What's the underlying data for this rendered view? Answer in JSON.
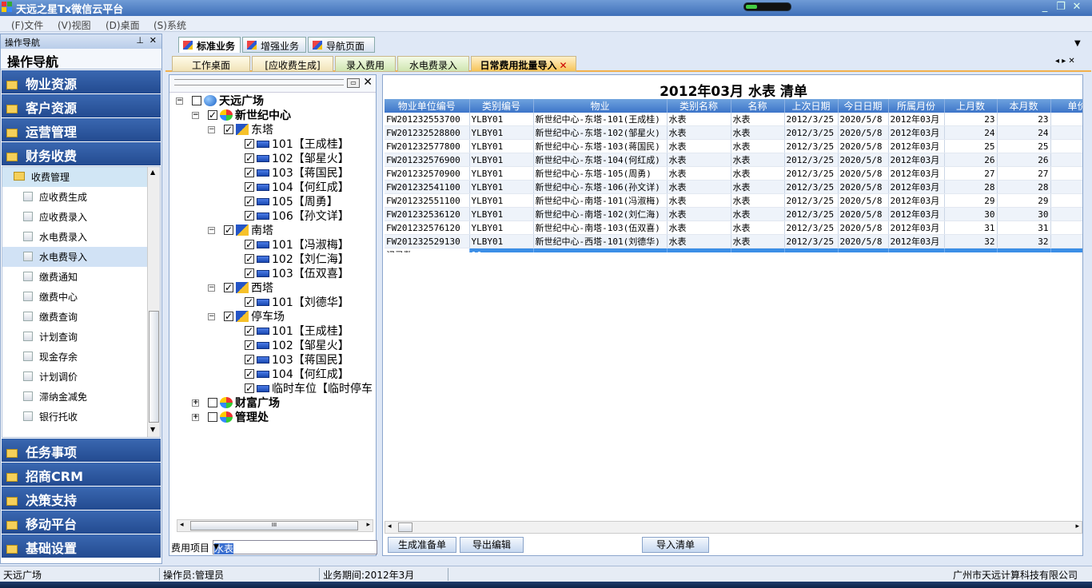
{
  "window": {
    "title": "天远之星Tx微信云平台"
  },
  "menu": [
    "(F)文件",
    "(V)视图",
    "(D)桌面",
    "(S)系统"
  ],
  "nav": {
    "header": "操作导航",
    "title": "操作导航",
    "categories_top": [
      "物业资源",
      "客户资源",
      "运营管理",
      "财务收费"
    ],
    "group": "收费管理",
    "items": [
      "应收费生成",
      "应收费录入",
      "水电费录入",
      "水电费导入",
      "缴费通知",
      "缴费中心",
      "缴费查询",
      "计划查询",
      "现金存余",
      "计划调价",
      "滞纳金减免",
      "银行托收"
    ],
    "selected_item": "水电费导入",
    "categories_bottom": [
      "任务事项",
      "招商CRM",
      "决策支持",
      "移动平台",
      "基础设置"
    ]
  },
  "tabs_top": [
    "标准业务",
    "增强业务",
    "导航页面"
  ],
  "tabs_doc": [
    "工作桌面",
    "[应收费生成]",
    "录入费用",
    "水电费录入",
    "日常费用批量导入"
  ],
  "tree": {
    "root": "天远广场",
    "center": "新世纪中心",
    "buildings": [
      {
        "name": "东塔",
        "units": [
          "101【王成桂】",
          "102【邹星火】",
          "103【蒋国民】",
          "104【何红成】",
          "105【周勇】",
          "106【孙文详】"
        ]
      },
      {
        "name": "南塔",
        "units": [
          "101【冯淑梅】",
          "102【刘仁海】",
          "103【伍双喜】"
        ]
      },
      {
        "name": "西塔",
        "units": [
          "101【刘德华】"
        ]
      },
      {
        "name": "停车场",
        "units": [
          "101【王成桂】",
          "102【邹星火】",
          "103【蒋国民】",
          "104【何红成】",
          "临时车位【临时停车】"
        ]
      }
    ],
    "others": [
      "财富广场",
      "管理处"
    ],
    "scroll_mid": "III",
    "fee_label": "费用项目",
    "fee_value": "水表"
  },
  "grid": {
    "title": "2012年03月  水表  清单",
    "columns": [
      "物业单位编号",
      "类别编号",
      "物业",
      "类别名称",
      "名称",
      "上次日期",
      "今日日期",
      "所属月份",
      "上月数",
      "本月数",
      "单价"
    ],
    "rows": [
      [
        "FW201232553700",
        "YLBY01",
        "新世纪中心-东塔-101(王成桂)",
        "水表",
        "水表",
        "2012/3/25",
        "2020/5/8",
        "2012年03月",
        "23",
        "23",
        "0."
      ],
      [
        "FW201232528800",
        "YLBY01",
        "新世纪中心-东塔-102(邹星火)",
        "水表",
        "水表",
        "2012/3/25",
        "2020/5/8",
        "2012年03月",
        "24",
        "24",
        "0."
      ],
      [
        "FW201232577800",
        "YLBY01",
        "新世纪中心-东塔-103(蒋国民)",
        "水表",
        "水表",
        "2012/3/25",
        "2020/5/8",
        "2012年03月",
        "25",
        "25",
        "0."
      ],
      [
        "FW201232576900",
        "YLBY01",
        "新世纪中心-东塔-104(何红成)",
        "水表",
        "水表",
        "2012/3/25",
        "2020/5/8",
        "2012年03月",
        "26",
        "26",
        "0."
      ],
      [
        "FW201232570900",
        "YLBY01",
        "新世纪中心-东塔-105(周勇)",
        "水表",
        "水表",
        "2012/3/25",
        "2020/5/8",
        "2012年03月",
        "27",
        "27",
        "0."
      ],
      [
        "FW201232541100",
        "YLBY01",
        "新世纪中心-东塔-106(孙文详)",
        "水表",
        "水表",
        "2012/3/25",
        "2020/5/8",
        "2012年03月",
        "28",
        "28",
        "0."
      ],
      [
        "FW201232551100",
        "YLBY01",
        "新世纪中心-南塔-101(冯淑梅)",
        "水表",
        "水表",
        "2012/3/25",
        "2020/5/8",
        "2012年03月",
        "29",
        "29",
        "0."
      ],
      [
        "FW201232536120",
        "YLBY01",
        "新世纪中心-南塔-102(刘仁海)",
        "水表",
        "水表",
        "2012/3/25",
        "2020/5/8",
        "2012年03月",
        "30",
        "30",
        "0."
      ],
      [
        "FW201232576120",
        "YLBY01",
        "新世纪中心-南塔-103(伍双喜)",
        "水表",
        "水表",
        "2012/3/25",
        "2020/5/8",
        "2012年03月",
        "31",
        "31",
        "0."
      ],
      [
        "FW201232529130",
        "YLBY01",
        "新世纪中心-西塔-101(刘德华)",
        "水表",
        "水表",
        "2012/3/25",
        "2020/5/8",
        "2012年03月",
        "32",
        "32",
        "0."
      ]
    ],
    "footer_label": "记录数",
    "footer_count": "10"
  },
  "buttons": {
    "gen": "生成准备单",
    "export": "导出编辑",
    "import": "导入清单"
  },
  "status": {
    "site": "天远广场",
    "operator": "操作员:管理员",
    "period": "业务期间:2012年3月",
    "company": "广州市天远计算科技有限公司"
  }
}
